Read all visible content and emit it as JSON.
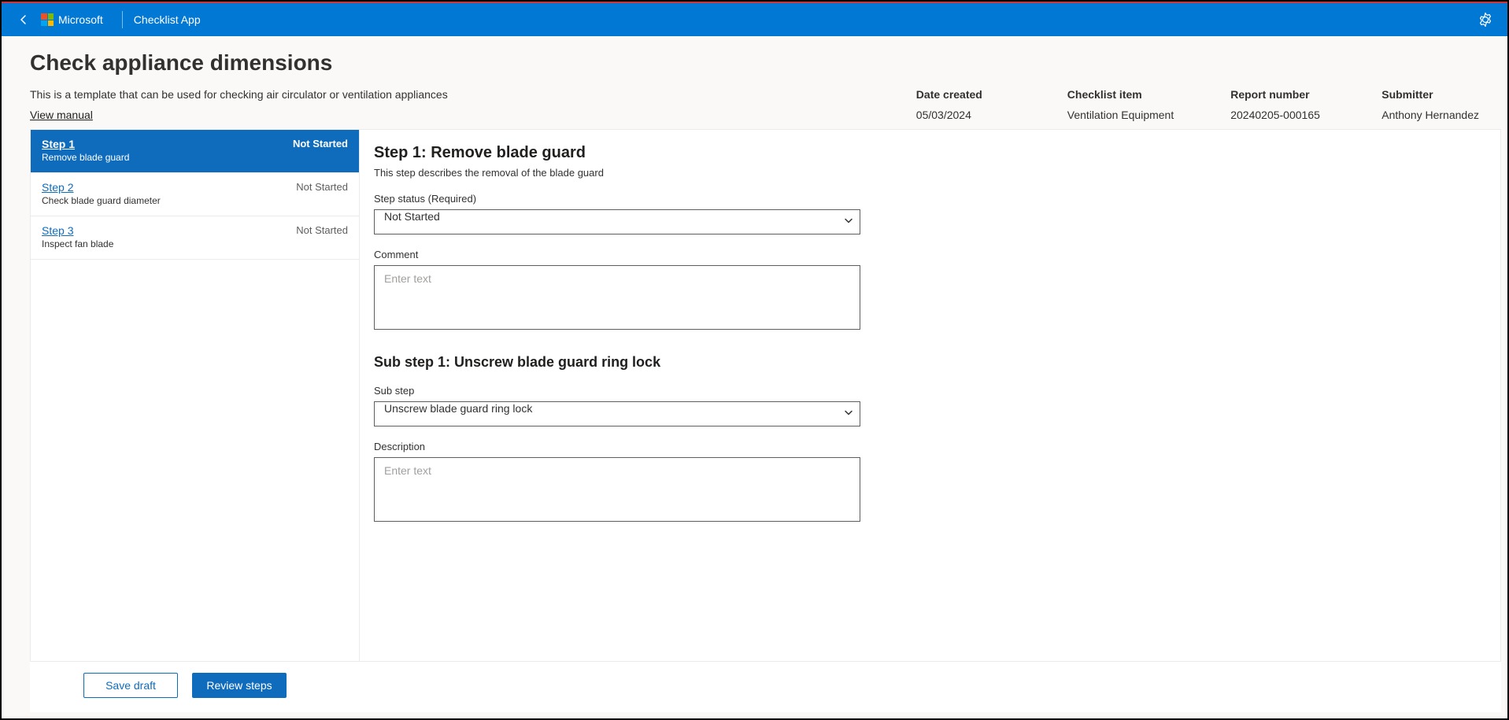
{
  "topbar": {
    "vendor": "Microsoft",
    "app_title": "Checklist App"
  },
  "page": {
    "title": "Check appliance dimensions",
    "description": "This is a template that can be used for checking air circulator or ventilation appliances",
    "view_manual": "View manual"
  },
  "metadata": {
    "date_created_label": "Date created",
    "date_created_value": "05/03/2024",
    "checklist_item_label": "Checklist item",
    "checklist_item_value": "Ventilation Equipment",
    "report_number_label": "Report number",
    "report_number_value": "20240205-000165",
    "submitter_label": "Submitter",
    "submitter_value": "Anthony Hernandez"
  },
  "steps": [
    {
      "label": "Step 1",
      "sub": "Remove blade guard",
      "status": "Not Started",
      "active": true
    },
    {
      "label": "Step 2",
      "sub": "Check blade guard diameter",
      "status": "Not Started",
      "active": false
    },
    {
      "label": "Step 3",
      "sub": "Inspect fan blade",
      "status": "Not Started",
      "active": false
    }
  ],
  "detail": {
    "title": "Step 1: Remove blade guard",
    "description": "This step describes the removal of the blade guard",
    "status_label": "Step status (Required)",
    "status_value": "Not Started",
    "comment_label": "Comment",
    "comment_placeholder": "Enter text",
    "substep_title": "Sub step 1: Unscrew blade guard ring lock",
    "substep_label": "Sub step",
    "substep_value": "Unscrew blade guard ring lock",
    "description_label": "Description",
    "description_placeholder": "Enter text"
  },
  "footer": {
    "save_draft": "Save draft",
    "review_steps": "Review steps"
  }
}
